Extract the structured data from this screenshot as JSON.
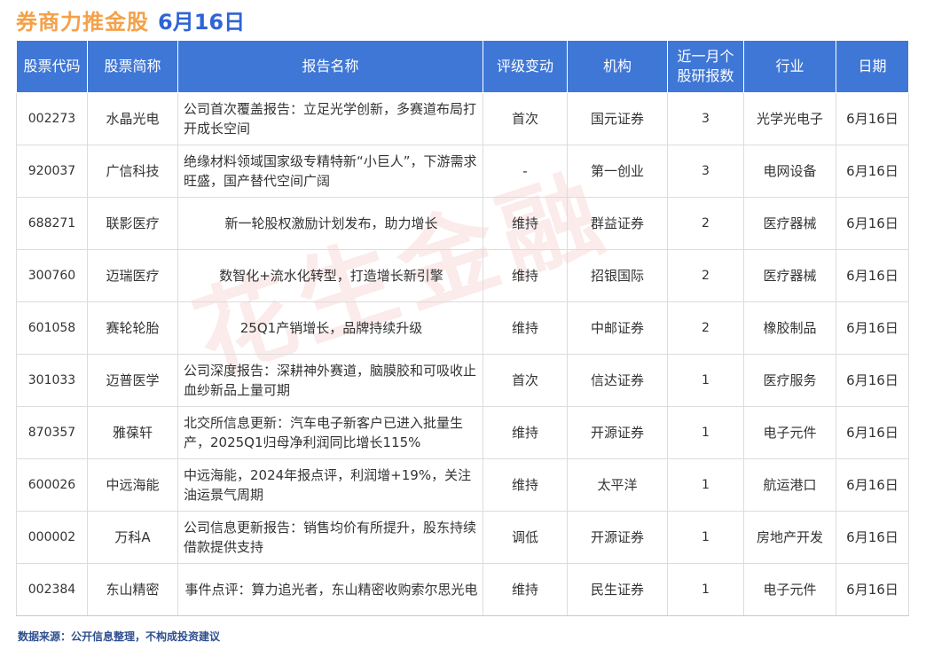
{
  "header": {
    "title": "券商力推金股",
    "date": "6月16日"
  },
  "table": {
    "columns": [
      "股票代码",
      "股票简称",
      "报告名称",
      "评级变动",
      "机构",
      "近一月个股研报数",
      "行业",
      "日期"
    ],
    "rows": [
      {
        "code": "002273",
        "name": "水晶光电",
        "report": "公司首次覆盖报告：立足光学创新，多赛道布局打开成长空间",
        "rating": "首次",
        "institution": "国元证券",
        "count": "3",
        "industry": "光学光电子",
        "date": "6月16日"
      },
      {
        "code": "920037",
        "name": "广信科技",
        "report": "绝缘材料领域国家级专精特新“小巨人”，下游需求旺盛，国产替代空间广阔",
        "rating": "-",
        "institution": "第一创业",
        "count": "3",
        "industry": "电网设备",
        "date": "6月16日"
      },
      {
        "code": "688271",
        "name": "联影医疗",
        "report": "新一轮股权激励计划发布，助力增长",
        "rating": "维持",
        "institution": "群益证券",
        "count": "2",
        "industry": "医疗器械",
        "date": "6月16日"
      },
      {
        "code": "300760",
        "name": "迈瑞医疗",
        "report": "数智化+流水化转型，打造增长新引擎",
        "rating": "维持",
        "institution": "招银国际",
        "count": "2",
        "industry": "医疗器械",
        "date": "6月16日"
      },
      {
        "code": "601058",
        "name": "赛轮轮胎",
        "report": "25Q1产销增长，品牌持续升级",
        "rating": "维持",
        "institution": "中邮证券",
        "count": "2",
        "industry": "橡胶制品",
        "date": "6月16日"
      },
      {
        "code": "301033",
        "name": "迈普医学",
        "report": "公司深度报告：深耕神外赛道，脑膜胶和可吸收止血纱新品上量可期",
        "rating": "首次",
        "institution": "信达证券",
        "count": "1",
        "industry": "医疗服务",
        "date": "6月16日"
      },
      {
        "code": "870357",
        "name": "雅葆轩",
        "report": "北交所信息更新：汽车电子新客户已进入批量生产，2025Q1归母净利润同比增长115%",
        "rating": "维持",
        "institution": "开源证券",
        "count": "1",
        "industry": "电子元件",
        "date": "6月16日"
      },
      {
        "code": "600026",
        "name": "中远海能",
        "report": "中远海能，2024年报点评，利润增+19%，关注油运景气周期",
        "rating": "维持",
        "institution": "太平洋",
        "count": "1",
        "industry": "航运港口",
        "date": "6月16日"
      },
      {
        "code": "000002",
        "name": "万科A",
        "report": "公司信息更新报告：销售均价有所提升，股东持续借款提供支持",
        "rating": "调低",
        "institution": "开源证券",
        "count": "1",
        "industry": "房地产开发",
        "date": "6月16日"
      },
      {
        "code": "002384",
        "name": "东山精密",
        "report": "事件点评：算力追光者，东山精密收购索尔思光电",
        "rating": "维持",
        "institution": "民生证券",
        "count": "1",
        "industry": "电子元件",
        "date": "6月16日"
      }
    ]
  },
  "footer": {
    "source": "数据来源：公开信息整理，不构成投资建议"
  },
  "watermark": "花生金融"
}
